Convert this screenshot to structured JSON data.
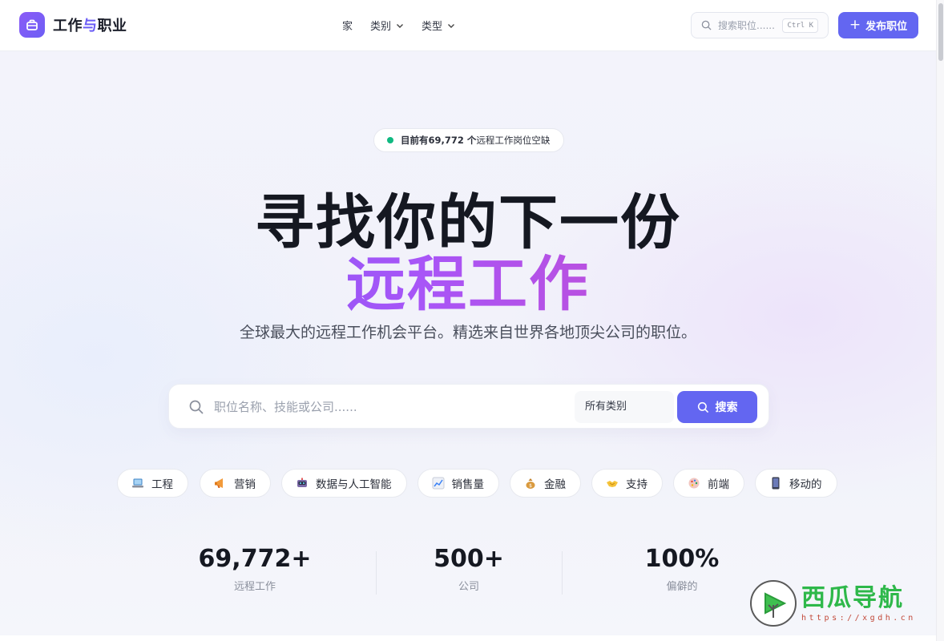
{
  "header": {
    "logo_text_a": "工作",
    "logo_text_b": "与",
    "logo_text_c": "职业",
    "nav": {
      "home": "家",
      "categories": "类别",
      "types": "类型"
    },
    "search_placeholder": "搜索职位......",
    "shortcut": "Ctrl K",
    "post_button": "发布职位"
  },
  "hero": {
    "badge_prefix": "目前有69,772 个",
    "badge_suffix": "远程工作岗位空缺",
    "title_line1": "寻找你的下一份",
    "title_line2": "远程工作",
    "subtitle": "全球最大的远程工作机会平台。精选来自世界各地顶尖公司的职位。"
  },
  "search": {
    "placeholder": "职位名称、技能或公司......",
    "category_select": "所有类别",
    "button": "搜索"
  },
  "categories": [
    {
      "icon": "laptop-icon",
      "label": "工程"
    },
    {
      "icon": "megaphone-icon",
      "label": "营销"
    },
    {
      "icon": "robot-icon",
      "label": "数据与人工智能"
    },
    {
      "icon": "chart-icon",
      "label": "销售量"
    },
    {
      "icon": "money-bag-icon",
      "label": "金融"
    },
    {
      "icon": "handshake-icon",
      "label": "支持"
    },
    {
      "icon": "palette-icon",
      "label": "前端"
    },
    {
      "icon": "phone-icon",
      "label": "移动的"
    }
  ],
  "stats": [
    {
      "value": "69,772+",
      "label": "远程工作"
    },
    {
      "value": "500+",
      "label": "公司"
    },
    {
      "value": "100%",
      "label": "偏僻的"
    }
  ],
  "watermark": {
    "title": "西瓜导航",
    "url": "https://xgdh.cn"
  },
  "colors": {
    "accent": "#6366f1",
    "status_dot": "#10b981",
    "gradient_start": "#6b5cf5",
    "gradient_end": "#db47b3"
  }
}
